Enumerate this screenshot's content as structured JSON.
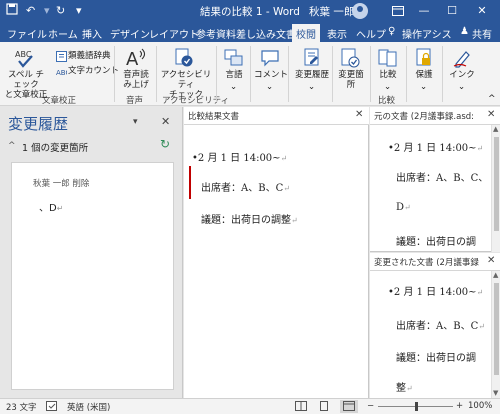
{
  "titlebar": {
    "title": "結果の比較 1 - Word",
    "user_name": "秋葉 一郎",
    "icons": [
      "save-icon",
      "undo-icon",
      "redo-icon",
      "customize-icon"
    ],
    "window_buttons": [
      "ribbon-display-icon",
      "minimize-icon",
      "maximize-icon",
      "close-icon"
    ]
  },
  "tabs": [
    "ファイル",
    "ホーム",
    "挿入",
    "デザイン",
    "レイアウト",
    "参考資料",
    "差し込み文書",
    "校閲",
    "表示",
    "ヘルプ",
    "操作アシス",
    "共有"
  ],
  "active_tab": "校閲",
  "ribbon": {
    "spell_check": "スペル チェック\nと文章校正",
    "thesaurus": "類義語辞典",
    "word_count": "文字カウント",
    "group_proofing": "文章校正",
    "read_aloud": "音声読\nみ上げ",
    "group_speech": "音声",
    "accessibility": "アクセシビリティ\nチェック",
    "group_accessibility": "アクセシビリティ",
    "language": "言語",
    "comment": "コメント",
    "track_changes": "変更履歴",
    "accept_changes": "変更箇\n所",
    "compare": "比較",
    "group_compare": "比較",
    "protect": "保護",
    "ink": "インク"
  },
  "revisions_pane": {
    "title": "変更履歴",
    "count_text": "1 個の変更箇所",
    "author_action": "秋葉 一郎  削除",
    "change_text": "、D"
  },
  "center_pane": {
    "title": "比較結果文書",
    "lines": [
      "2 月 1 日 14:00~",
      "出席者：A、B、C",
      "議題：出荷日の調整"
    ]
  },
  "original_pane": {
    "title": "元の文書 (2月議事録.asd:",
    "lines": [
      "2 月 1 日 14:00~",
      "出席者：A、B、C、",
      "D",
      "議題：出荷日の調"
    ]
  },
  "revised_pane": {
    "title": "変更された文書 (2月議事録",
    "lines": [
      "2 月 1 日 14:00~",
      "出席者：A、B、C",
      "議題：出荷日の調",
      "整"
    ]
  },
  "statusbar": {
    "word_count": "23 文字",
    "language": "英語 (米国)",
    "zoom": "100%",
    "zoom_fraction": 0.5
  },
  "colors": {
    "brand": "#2b579a",
    "change_bar": "#c00000"
  }
}
